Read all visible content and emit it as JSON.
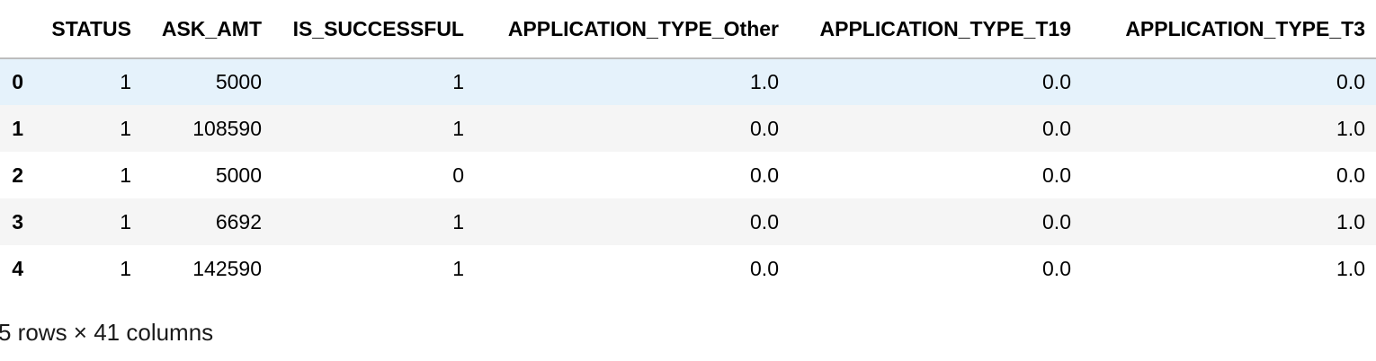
{
  "table": {
    "columns": [
      "",
      "STATUS",
      "ASK_AMT",
      "IS_SUCCESSFUL",
      "APPLICATION_TYPE_Other",
      "APPLICATION_TYPE_T19",
      "APPLICATION_TYPE_T3"
    ],
    "rows": [
      {
        "index": "0",
        "cells": [
          "1",
          "5000",
          "1",
          "1.0",
          "0.0",
          "0.0"
        ]
      },
      {
        "index": "1",
        "cells": [
          "1",
          "108590",
          "1",
          "0.0",
          "0.0",
          "1.0"
        ]
      },
      {
        "index": "2",
        "cells": [
          "1",
          "5000",
          "0",
          "0.0",
          "0.0",
          "0.0"
        ]
      },
      {
        "index": "3",
        "cells": [
          "1",
          "6692",
          "1",
          "0.0",
          "0.0",
          "1.0"
        ]
      },
      {
        "index": "4",
        "cells": [
          "1",
          "142590",
          "1",
          "0.0",
          "0.0",
          "1.0"
        ]
      }
    ]
  },
  "footer": {
    "shape_text": "5 rows × 41 columns"
  },
  "colors": {
    "header_border": "#bdbdbd",
    "row_stripe": "#f5f5f5",
    "row_hover": "#e5f2fb"
  }
}
